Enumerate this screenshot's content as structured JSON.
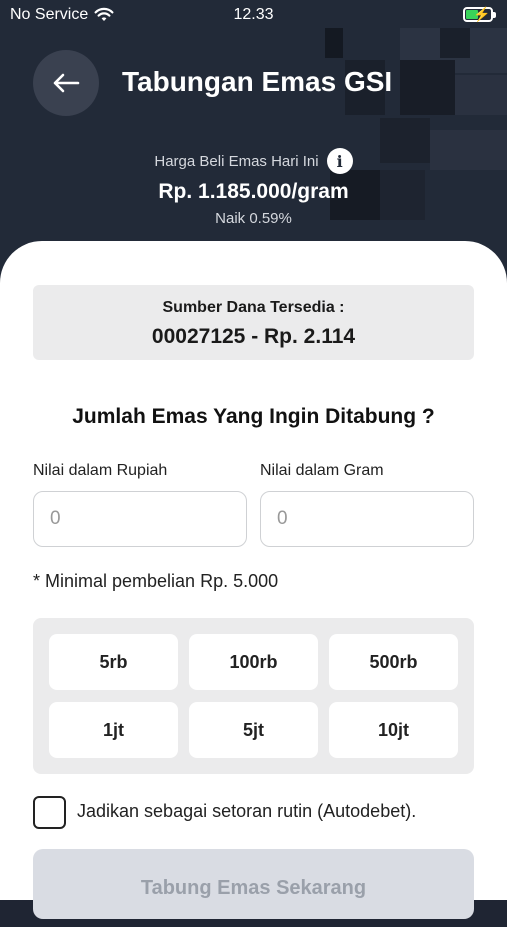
{
  "status_bar": {
    "carrier": "No Service",
    "time": "12.33"
  },
  "header": {
    "title": "Tabungan Emas GSI",
    "price_label": "Harga Beli Emas Hari Ini",
    "price_value": "Rp. 1.185.000/gram",
    "price_change": "Naik 0.59%",
    "info_glyph": "i"
  },
  "fund": {
    "label": "Sumber Dana Tersedia :",
    "value": "00027125 - Rp. 2.114"
  },
  "form": {
    "question": "Jumlah Emas Yang Ingin Ditabung ?",
    "rupiah_label": "Nilai dalam Rupiah",
    "rupiah_value": "0",
    "gram_label": "Nilai dalam Gram",
    "gram_value": "0",
    "minimum_hint": "* Minimal pembelian Rp. 5.000"
  },
  "quick_amounts": [
    "5rb",
    "100rb",
    "500rb",
    "1jt",
    "5jt",
    "10jt"
  ],
  "autodebet_label": "Jadikan sebagai setoran rutin (Autodebet).",
  "submit_label": "Tabung Emas Sekarang",
  "icons": {
    "back": "arrow-left-icon",
    "info": "info-icon",
    "wifi": "wifi-icon",
    "battery": "battery-charging-icon"
  },
  "colors": {
    "header_bg": "#222a38",
    "battery_fill": "#39d35a",
    "submit_disabled_bg": "#d9dce3",
    "submit_disabled_text": "#9aa0aa"
  }
}
